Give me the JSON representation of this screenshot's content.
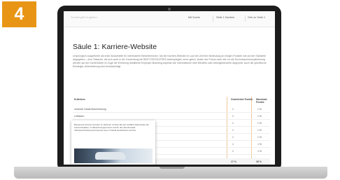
{
  "step": {
    "number": "4"
  },
  "topbar": {
    "search_placeholder": "Suchbegriff eingeben",
    "buttons": [
      "Mit Suche",
      "Seite 1 Karriere",
      "Geh zu Seite 1"
    ]
  },
  "page": {
    "title": "Säule 1: Karriere-Website",
    "intro": "Ursprünglich ausgeführte als erste Anlaufstelle für interessierte Bewerberinnen, hat die Karriere-Website im Lauf der Zeit ihre Bedeutung an einigen Punkten wie auf der Startseite abgegeben – eine Tatsache, die sich auch in der Gewichtung bei BEST RECRUITERS widerspiegelt, wenn gleich, finden den Fokus nach wie vor die Suchmaschinenoptimierung werden auf der Karriereseite im Zuge der Erhebung detaillierte Employer-Branding-Aspekte wie Informationen über Benefits oder Arbeitgeberwerte abgeprüft. Auch die spezifische Einsteiger-Unterstützung wird berücksichtigt."
  },
  "table": {
    "headers": [
      "Kriterium",
      "Gewichtete Punkte",
      "Maximale Punkte"
    ],
    "rows": [
      {
        "label": "Unterste Detail-Beschreibung",
        "score": "1",
        "max": "1 %"
      },
      {
        "label": "Leitfaden",
        "score": "1",
        "max": "1 %"
      },
      {
        "label": "",
        "score": "1",
        "max": "1 %"
      },
      {
        "label": "",
        "score": "1",
        "max": "1 %"
      },
      {
        "label": "",
        "score": "1",
        "max": "1 %"
      },
      {
        "label": "",
        "score": "1",
        "max": "1 %"
      },
      {
        "label": "",
        "score": "1",
        "max": "1 %"
      }
    ],
    "totals": {
      "score": "17 %",
      "max": "38 %"
    }
  },
  "tooltip": {
    "text": "Bewertend wird der Kunden im Rahmen 10 Sek-Teil der Luftfahrt-Stand dass der Lebenssituation, im Bewerbungsprozess und für den Arbeitsmarkt Videobeschreibung-Komponent aus im Detail aussichtslos auf Ihre."
  }
}
